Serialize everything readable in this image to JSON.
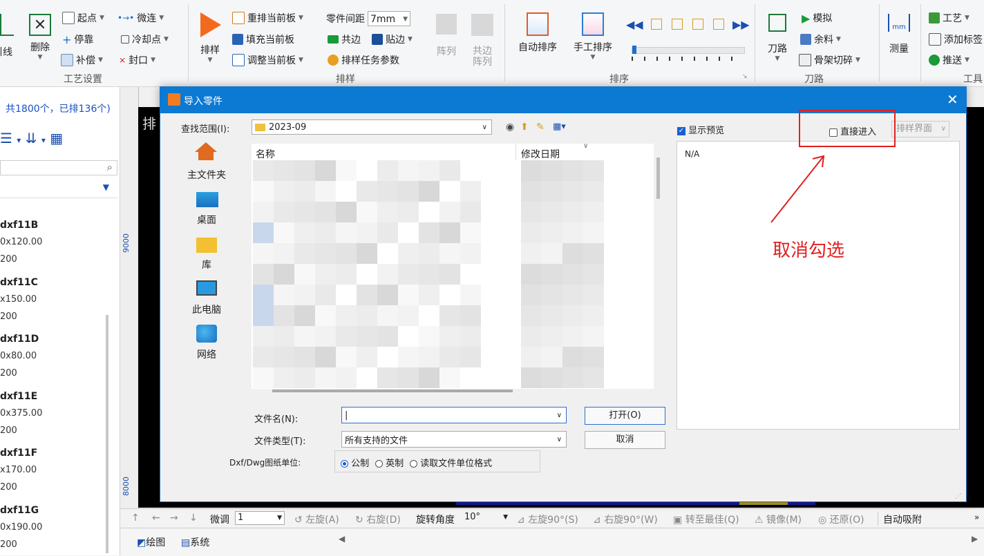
{
  "ribbon": {
    "process_tools": {
      "line_label": "引线",
      "delete_label": "删除",
      "start_point": "起点",
      "micro_connect": "微连",
      "stop_point": "停靠",
      "cooling_point": "冷却点",
      "compensation": "补偿",
      "seal": "封口",
      "group_label": "工艺设置"
    },
    "nesting": {
      "nest_button": "排样",
      "renest_current": "重排当前板",
      "fill_current": "填充当前板",
      "adjust_current": "调整当前板",
      "part_spacing_label": "零件间距",
      "part_spacing_value": "7mm",
      "common_edge": "共边",
      "stick_edge": "贴边",
      "task_params": "排样任务参数",
      "array_label": "阵列",
      "common_edge_array_line1": "共边",
      "common_edge_array_line2": "阵列",
      "group_label": "排样"
    },
    "sort": {
      "auto_sort": "自动排序",
      "manual_sort": "手工排序",
      "group_label": "排序"
    },
    "tool_path": {
      "tool_path": "刀路",
      "simulate": "模拟",
      "remnant": "余料",
      "skeleton_cut": "骨架切碎",
      "group_label": "刀路"
    },
    "measure": {
      "measure": "测量",
      "unit_icon_text": "mm"
    },
    "tools": {
      "craft": "工艺",
      "add_label": "添加标签",
      "push": "推送",
      "group_label": "工具"
    }
  },
  "left_panel": {
    "summary": "共1800个，已排136个)",
    "parts": [
      {
        "name": "dxf11B",
        "size": "0x120.00",
        "qty": "200"
      },
      {
        "name": "dxf11C",
        "size": "x150.00",
        "qty": "200"
      },
      {
        "name": "dxf11D",
        "size": "0x80.00",
        "qty": "200"
      },
      {
        "name": "dxf11E",
        "size": "0x375.00",
        "qty": "200"
      },
      {
        "name": "dxf11F",
        "size": "x170.00",
        "qty": "200"
      },
      {
        "name": "dxf11G",
        "size": "0x190.00",
        "qty": "200"
      }
    ]
  },
  "canvas": {
    "partial_label": "排",
    "ruler_9000": "9000",
    "ruler_8000": "8000"
  },
  "bottom_toolbar": {
    "fine_adjust_label": "微调",
    "fine_adjust_value": "1",
    "rotate_left": "左旋(A)",
    "rotate_right": "右旋(D)",
    "rotate_angle_label": "旋转角度",
    "rotate_angle_value": "10°",
    "left_rotate_90": "左旋90°(S)",
    "right_rotate_90": "右旋90°(W)",
    "to_best": "转至最佳(Q)",
    "mirror": "镜像(M)",
    "restore": "还原(O)",
    "auto_snap": "自动吸附"
  },
  "bottom_tabs": {
    "drawing": "绘图",
    "system": "系统"
  },
  "dialog": {
    "title": "导入零件",
    "lookin_label": "查找范围(I):",
    "lookin_value": "2023-09",
    "places": [
      "主文件夹",
      "桌面",
      "库",
      "此电脑",
      "网络"
    ],
    "col_name": "名称",
    "col_modified": "修改日期",
    "filename_label": "文件名(N):",
    "filename_value": "",
    "filetype_label": "文件类型(T):",
    "filetype_value": "所有支持的文件",
    "open_button": "打开(O)",
    "cancel_button": "取消",
    "unit_label": "Dxf/Dwg图纸单位:",
    "unit_metric": "公制",
    "unit_imperial": "英制",
    "unit_read": "读取文件单位格式",
    "show_preview": "显示预览",
    "direct_enter": "直接进入",
    "target_select": "排样界面",
    "preview_text": "N/A"
  },
  "annotation": {
    "text": "取消勾选",
    "color": "#e02020"
  }
}
